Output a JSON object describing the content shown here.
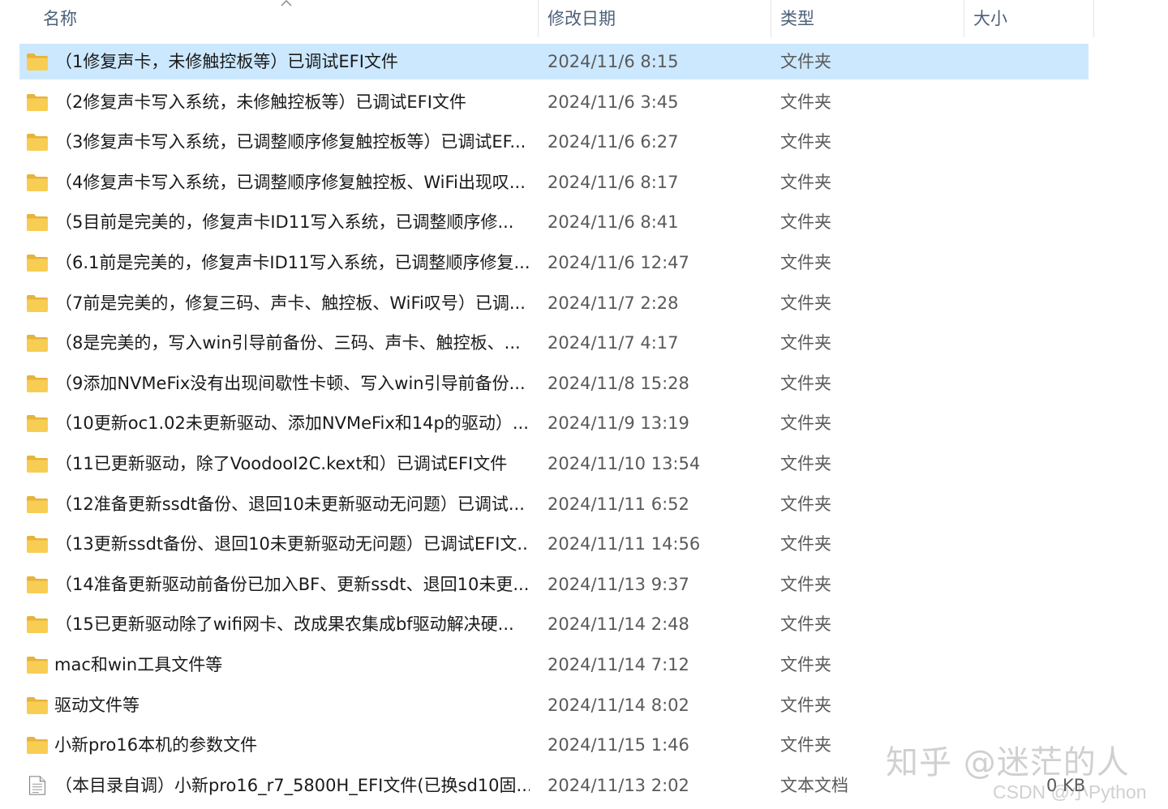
{
  "columns": {
    "name": "名称",
    "date": "修改日期",
    "type": "类型",
    "size": "大小"
  },
  "colors": {
    "selected_row": "#cce8ff",
    "folder_body": "#f8cd54",
    "folder_tab": "#e8b33a",
    "header_text": "#4c607a"
  },
  "rows": [
    {
      "icon": "folder-icon",
      "name": "（1修复声卡，未修触控板等）已调试EFI文件",
      "date": "2024/11/6 8:15",
      "type": "文件夹",
      "size": "",
      "selected": true
    },
    {
      "icon": "folder-icon",
      "name": "（2修复声卡写入系统，未修触控板等）已调试EFI文件",
      "date": "2024/11/6 3:45",
      "type": "文件夹",
      "size": ""
    },
    {
      "icon": "folder-icon",
      "name": "（3修复声卡写入系统，已调整顺序修复触控板等）已调试EF...",
      "date": "2024/11/6 6:27",
      "type": "文件夹",
      "size": ""
    },
    {
      "icon": "folder-icon",
      "name": "（4修复声卡写入系统，已调整顺序修复触控板、WiFi出现叹...",
      "date": "2024/11/6 8:17",
      "type": "文件夹",
      "size": ""
    },
    {
      "icon": "folder-icon",
      "name": "（5目前是完美的，修复声卡ID11写入系统，已调整顺序修...",
      "date": "2024/11/6 8:41",
      "type": "文件夹",
      "size": ""
    },
    {
      "icon": "folder-icon",
      "name": "（6.1前是完美的，修复声卡ID11写入系统，已调整顺序修复...",
      "date": "2024/11/6 12:47",
      "type": "文件夹",
      "size": ""
    },
    {
      "icon": "folder-icon",
      "name": "（7前是完美的，修复三码、声卡、触控板、WiFi叹号）已调...",
      "date": "2024/11/7 2:28",
      "type": "文件夹",
      "size": ""
    },
    {
      "icon": "folder-icon",
      "name": "（8是完美的，写入win引导前备份、三码、声卡、触控板、...",
      "date": "2024/11/7 4:17",
      "type": "文件夹",
      "size": ""
    },
    {
      "icon": "folder-icon",
      "name": "（9添加NVMeFix没有出现间歇性卡顿、写入win引导前备份...",
      "date": "2024/11/8 15:28",
      "type": "文件夹",
      "size": ""
    },
    {
      "icon": "folder-icon",
      "name": "（10更新oc1.02未更新驱动、添加NVMeFix和14p的驱动）...",
      "date": "2024/11/9 13:19",
      "type": "文件夹",
      "size": ""
    },
    {
      "icon": "folder-icon",
      "name": "（11已更新驱动，除了VoodooI2C.kext和）已调试EFI文件",
      "date": "2024/11/10 13:54",
      "type": "文件夹",
      "size": ""
    },
    {
      "icon": "folder-icon",
      "name": "（12准备更新ssdt备份、退回10未更新驱动无问题）已调试...",
      "date": "2024/11/11 6:52",
      "type": "文件夹",
      "size": ""
    },
    {
      "icon": "folder-icon",
      "name": "（13更新ssdt备份、退回10未更新驱动无问题）已调试EFI文...",
      "date": "2024/11/11 14:56",
      "type": "文件夹",
      "size": ""
    },
    {
      "icon": "folder-icon",
      "name": "（14准备更新驱动前备份已加入BF、更新ssdt、退回10未更...",
      "date": "2024/11/13 9:37",
      "type": "文件夹",
      "size": ""
    },
    {
      "icon": "folder-icon",
      "name": "（15已更新驱动除了wifi网卡、改成果农集成bf驱动解决硬...",
      "date": "2024/11/14 2:48",
      "type": "文件夹",
      "size": ""
    },
    {
      "icon": "folder-icon",
      "name": "mac和win工具文件等",
      "date": "2024/11/14 7:12",
      "type": "文件夹",
      "size": ""
    },
    {
      "icon": "folder-icon",
      "name": "驱动文件等",
      "date": "2024/11/14 8:02",
      "type": "文件夹",
      "size": ""
    },
    {
      "icon": "folder-icon",
      "name": "小新pro16本机的参数文件",
      "date": "2024/11/15 1:46",
      "type": "文件夹",
      "size": ""
    },
    {
      "icon": "text-file-icon",
      "name": "（本目录自调）小新pro16_r7_5800H_EFI文件(已换sd10固...",
      "date": "2024/11/13 2:02",
      "type": "文本文档",
      "size": "0 KB"
    }
  ],
  "watermark": {
    "zhihu": "知乎 @迷茫的人",
    "csdn": "CSDN @小Python"
  }
}
